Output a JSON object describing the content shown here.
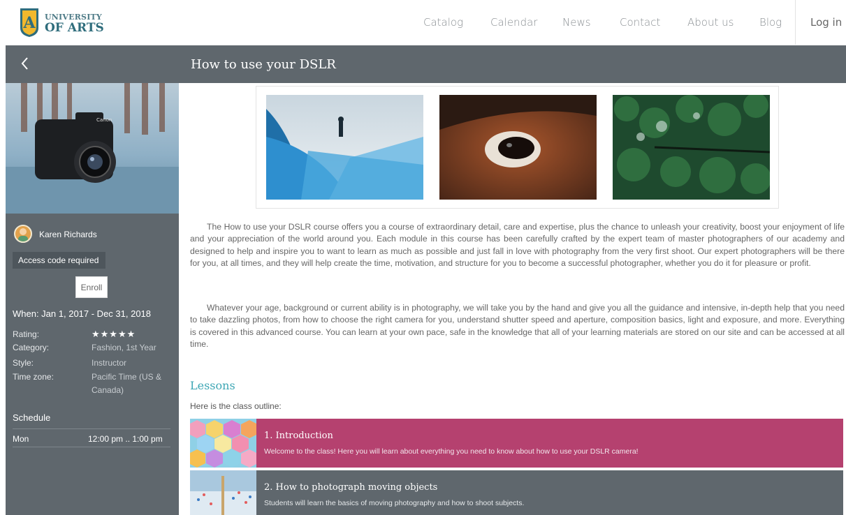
{
  "brand": {
    "line1": "UNIVERSITY",
    "line2": "OF ARTS"
  },
  "nav": {
    "items": [
      "Catalog",
      "Calendar",
      "News",
      "Contact",
      "About us",
      "Blog"
    ],
    "login": "Log in"
  },
  "course": {
    "title": "How to use your DSLR"
  },
  "sidebar": {
    "author": "Karen Richards",
    "access": "Access code required",
    "enroll": "Enroll",
    "when": "When: Jan 1, 2017 - Dec 31, 2018",
    "rating_label": "Rating:",
    "rating_stars": "★★★★★",
    "category_label": "Category:",
    "category_value": "Fashion, 1st Year",
    "style_label": "Style:",
    "style_value": "Instructor",
    "timezone_label": "Time zone:",
    "timezone_value": "Pacific Time (US & Canada)",
    "schedule_title": "Schedule",
    "schedule": [
      {
        "day": "Mon",
        "time": "12:00 pm .. 1:00 pm"
      }
    ]
  },
  "content": {
    "para1": "The How to use your DSLR course offers you a course of extraordinary detail, care and expertise, plus the chance to unleash your creativity, boost your enjoyment of life and your appreciation of the world around you. Each module in this course has been carefully crafted by the expert team of master photographers of our academy and designed to help and inspire you to want to learn as much as possible and just fall in love with photography from the very first shoot. Our expert photographers will be there for you, at all times, and they will help create the time, motivation, and structure for you to become a successful photographer, whether you do it for pleasure or profit.",
    "para2": "Whatever your age, background or current ability is in photography, we will take you by the hand and give you all the guidance and intensive, in-depth help that you need to take dazzling photos, from how to choose the right camera for you, understand shutter speed and aperture, composition basics, light and exposure, and more. Everything is covered in this advanced course. You can learn at your own pace, safe in the knowledge that all of your learning materials are stored on our site and can be accessed at all time.",
    "lessons_heading": "Lessons",
    "outline": "Here is the class outline:",
    "lessons": [
      {
        "title": "1. Introduction",
        "desc": "Welcome to the class! Here you will learn about everything you need to know about how to use your DSLR camera!",
        "color": "#b5416f"
      },
      {
        "title": "2. How to photograph moving objects",
        "desc": "Students will learn the basics of moving photography and how to shoot subjects.",
        "color": "#5f676d"
      }
    ]
  },
  "colors": {
    "header": "#5f676d",
    "accent": "#3fa7b5",
    "lesson1": "#b5416f"
  }
}
